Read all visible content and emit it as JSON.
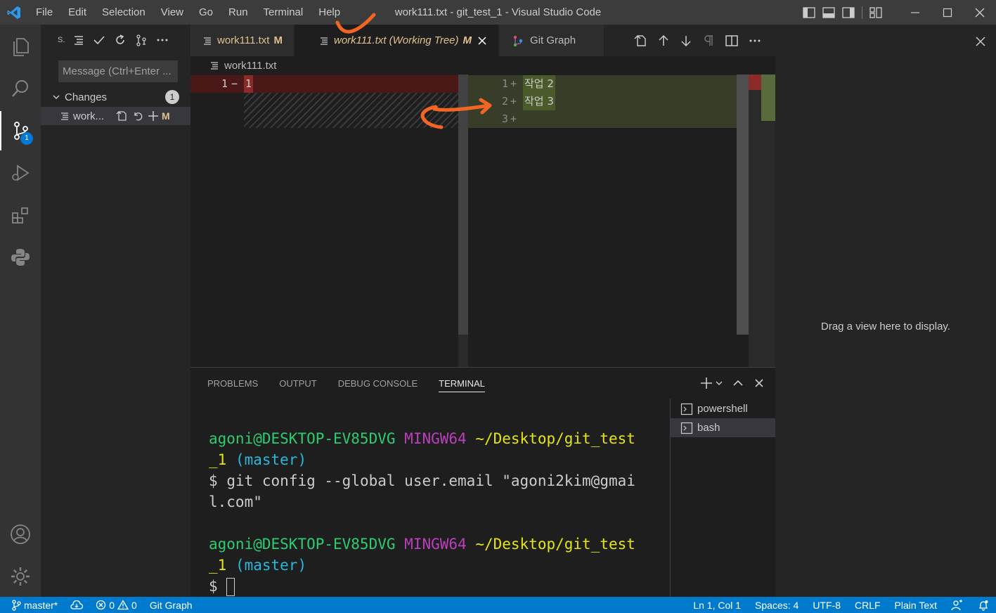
{
  "titlebar": {
    "menu": [
      "File",
      "Edit",
      "Selection",
      "View",
      "Go",
      "Run",
      "Terminal",
      "Help"
    ],
    "title": "work111.txt - git_test_1 - Visual Studio Code"
  },
  "activitybar": {
    "scm_badge": "1"
  },
  "sidebar": {
    "title": "S.",
    "message_placeholder": "Message (Ctrl+Enter ...",
    "changes_label": "Changes",
    "changes_count": "1",
    "file_name": "work...",
    "file_status": "M"
  },
  "tabs": [
    {
      "label": "work111.txt",
      "status": "M"
    },
    {
      "label": "work111.txt (Working Tree)",
      "status": "M"
    },
    {
      "label": "Git Graph"
    }
  ],
  "breadcrumb": "work111.txt",
  "diff": {
    "left": {
      "line_number": "1",
      "marker": "−",
      "content": "1"
    },
    "right": [
      {
        "line_number": "1",
        "marker": "+",
        "content": "작업 2"
      },
      {
        "line_number": "2",
        "marker": "+",
        "content": "작업 3"
      },
      {
        "line_number": "3",
        "marker": "+",
        "content": ""
      }
    ]
  },
  "aux_panel": {
    "text": "Drag a view here to display."
  },
  "panel": {
    "tabs": [
      "PROBLEMS",
      "OUTPUT",
      "DEBUG CONSOLE",
      "TERMINAL"
    ],
    "active_tab": "TERMINAL",
    "terminal": {
      "user_host": "agoni@DESKTOP-EV85DVG",
      "env": "MINGW64",
      "path_1": "~/Desktop/git_test",
      "path_2": "_1",
      "branch": "(master)",
      "prompt": "$",
      "command_1": "git config --global user.email \"agoni2kim@gmai",
      "command_2": "l.com\""
    },
    "terminal_list": [
      "powershell",
      "bash"
    ]
  },
  "statusbar": {
    "branch": "master*",
    "errors": "0",
    "warnings": "0",
    "git_graph": "Git Graph",
    "position": "Ln 1, Col 1",
    "spaces": "Spaces: 4",
    "encoding": "UTF-8",
    "eol": "CRLF",
    "language": "Plain Text"
  },
  "colors": {
    "accent": "#007acc",
    "modified": "#e2c08d",
    "annotation": "#f26522"
  }
}
